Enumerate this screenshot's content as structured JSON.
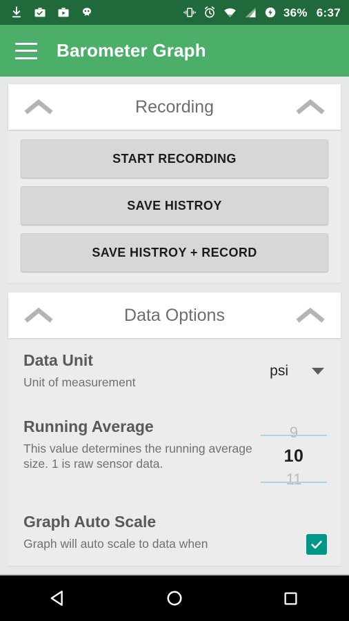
{
  "status_bar": {
    "background": "#20693a",
    "left_icons": [
      "download-icon",
      "work-briefcase-check-icon",
      "app-store-bag-icon",
      "cyanogenmod-robot-icon"
    ],
    "right_icons": [
      "vibrate-icon",
      "alarm-clock-icon",
      "wifi-icon",
      "cellular-signal-icon",
      "battery-charging-icon"
    ],
    "battery_percent": "36%",
    "clock": "6:37"
  },
  "app_bar": {
    "background": "#4caf69",
    "menu_icon": "hamburger-menu-icon",
    "title": "Barometer Graph"
  },
  "sections": {
    "recording": {
      "title": "Recording",
      "collapse_icon_left": "chevron-up-icon",
      "collapse_icon_right": "chevron-up-icon",
      "buttons": [
        {
          "label": "START RECORDING"
        },
        {
          "label": "SAVE HISTROY"
        },
        {
          "label": "SAVE HISTROY + RECORD"
        }
      ]
    },
    "data_options": {
      "title": "Data Options",
      "collapse_icon_left": "chevron-up-icon",
      "collapse_icon_right": "chevron-up-icon",
      "preferences": [
        {
          "title": "Data Unit",
          "summary": "Unit of measurement",
          "widget": "spinner",
          "value": "psi",
          "dropdown_icon": "caret-down-icon"
        },
        {
          "title": "Running Average",
          "summary": "This value determines the running average size. 1 is raw sensor data.",
          "widget": "number-picker",
          "value_above": "9",
          "value": "10",
          "value_below": "11",
          "divider_color": "#a9d3e8"
        },
        {
          "title": "Graph Auto Scale",
          "summary": "Graph will auto scale to data when",
          "widget": "checkbox",
          "checked": true,
          "checkbox_color": "#009688"
        }
      ]
    }
  },
  "nav_bar": {
    "background": "#000000",
    "buttons": [
      "back-triangle-icon",
      "home-circle-icon",
      "recents-square-icon"
    ]
  }
}
